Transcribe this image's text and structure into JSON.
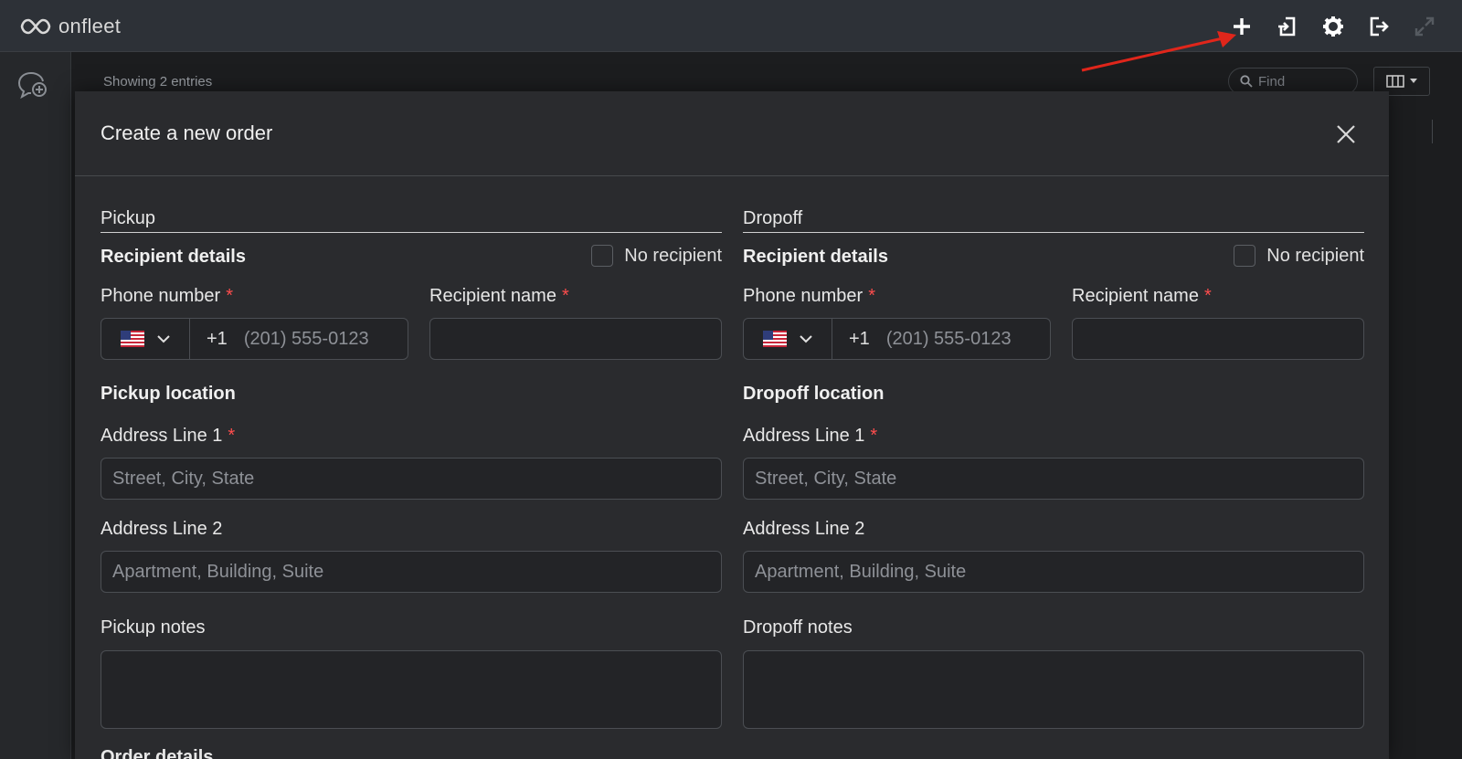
{
  "app": {
    "brand": "onfleet"
  },
  "topbar": {
    "icons": [
      "plus-icon",
      "import-icon",
      "gear-icon",
      "logout-icon",
      "expand-icon"
    ]
  },
  "background": {
    "entries_text": "Showing 2 entries",
    "find_placeholder": "Find"
  },
  "annotation": {
    "arrow_color": "#e0261b"
  },
  "modal": {
    "title": "Create a new order",
    "pickup": {
      "section_title": "Pickup",
      "recipient_title": "Recipient details",
      "no_recipient_label": "No recipient",
      "phone_label": "Phone number",
      "required_mark": "*",
      "country_code": "+1",
      "phone_placeholder": "(201) 555-0123",
      "name_label": "Recipient name",
      "location_title": "Pickup location",
      "addr1_label": "Address Line 1",
      "addr1_placeholder": "Street, City, State",
      "addr2_label": "Address Line 2",
      "addr2_placeholder": "Apartment, Building, Suite",
      "notes_label": "Pickup notes"
    },
    "dropoff": {
      "section_title": "Dropoff",
      "recipient_title": "Recipient details",
      "no_recipient_label": "No recipient",
      "phone_label": "Phone number",
      "required_mark": "*",
      "country_code": "+1",
      "phone_placeholder": "(201) 555-0123",
      "name_label": "Recipient name",
      "location_title": "Dropoff location",
      "addr1_label": "Address Line 1",
      "addr1_placeholder": "Street, City, State",
      "addr2_label": "Address Line 2",
      "addr2_placeholder": "Apartment, Building, Suite",
      "notes_label": "Dropoff notes"
    },
    "partial_next_section": "Order details"
  },
  "colors": {
    "required": "#ff4d4d",
    "modal_bg": "#2a2b2e",
    "topbar_bg": "#2d3137"
  }
}
